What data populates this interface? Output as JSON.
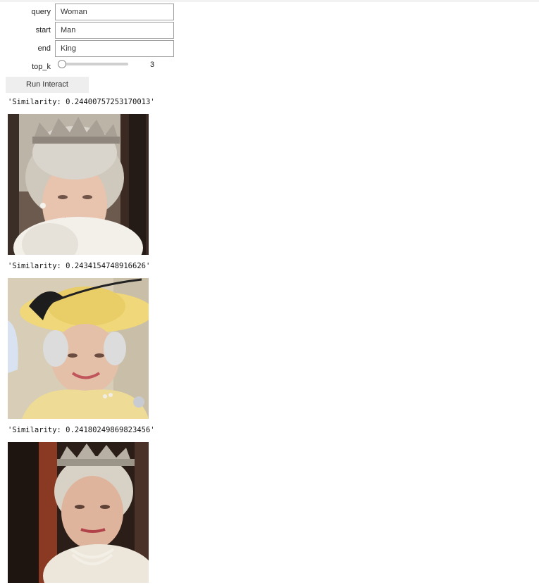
{
  "form": {
    "query": {
      "label": "query",
      "value": "Woman"
    },
    "start": {
      "label": "start",
      "value": "Man"
    },
    "end": {
      "label": "end",
      "value": "King"
    },
    "top_k": {
      "label": "top_k",
      "value": "3",
      "min_fraction": 0.0
    },
    "run_label": "Run Interact"
  },
  "results": [
    {
      "similarity_text": "'Similarity: 0.24400757253170013'",
      "image": "portrait-crown-fur-stole"
    },
    {
      "similarity_text": "'Similarity: 0.2434154748916626'",
      "image": "portrait-yellow-hat-waving"
    },
    {
      "similarity_text": "'Similarity: 0.24180249869823456'",
      "image": "portrait-crown-carriage-window"
    }
  ]
}
